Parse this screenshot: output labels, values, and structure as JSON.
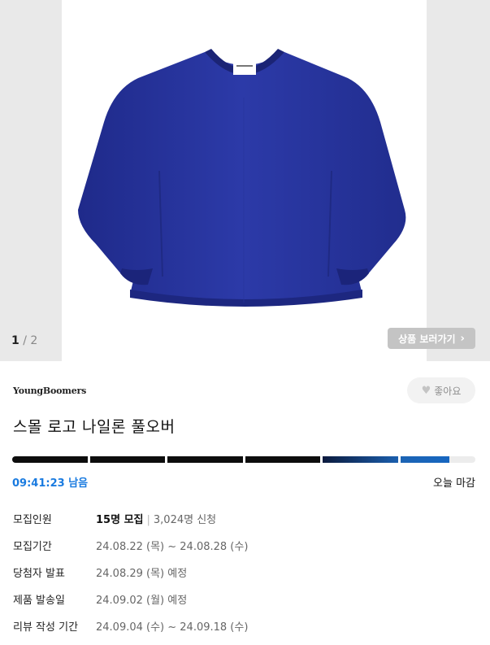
{
  "gallery": {
    "current": "1",
    "separator": "/",
    "total": "2",
    "view_button_label": "상품 보러가기",
    "view_button_icon": "chevron-right-icon"
  },
  "product": {
    "brand": "YoungBoomers",
    "like_label": "좋아요",
    "like_icon": "heart-icon",
    "title": "스몰 로고 나일론 풀오버"
  },
  "countdown": {
    "remaining": "09:41:23 남음",
    "deadline": "오늘 마감",
    "progress": 0.97,
    "accent_color": "#1a7be0"
  },
  "details": {
    "recruit_label": "모집인원",
    "recruit_count": "15명 모집",
    "applicants": "3,024명 신청",
    "period_label": "모집기간",
    "period_value": "24.08.22 (목) ~ 24.08.28 (수)",
    "announce_label": "당첨자 발표",
    "announce_value": "24.08.29 (목) 예정",
    "ship_label": "제품 발송일",
    "ship_value": "24.09.02 (월) 예정",
    "review_label": "리뷰 작성 기간",
    "review_value": "24.09.04 (수) ~ 24.09.18 (수)"
  }
}
